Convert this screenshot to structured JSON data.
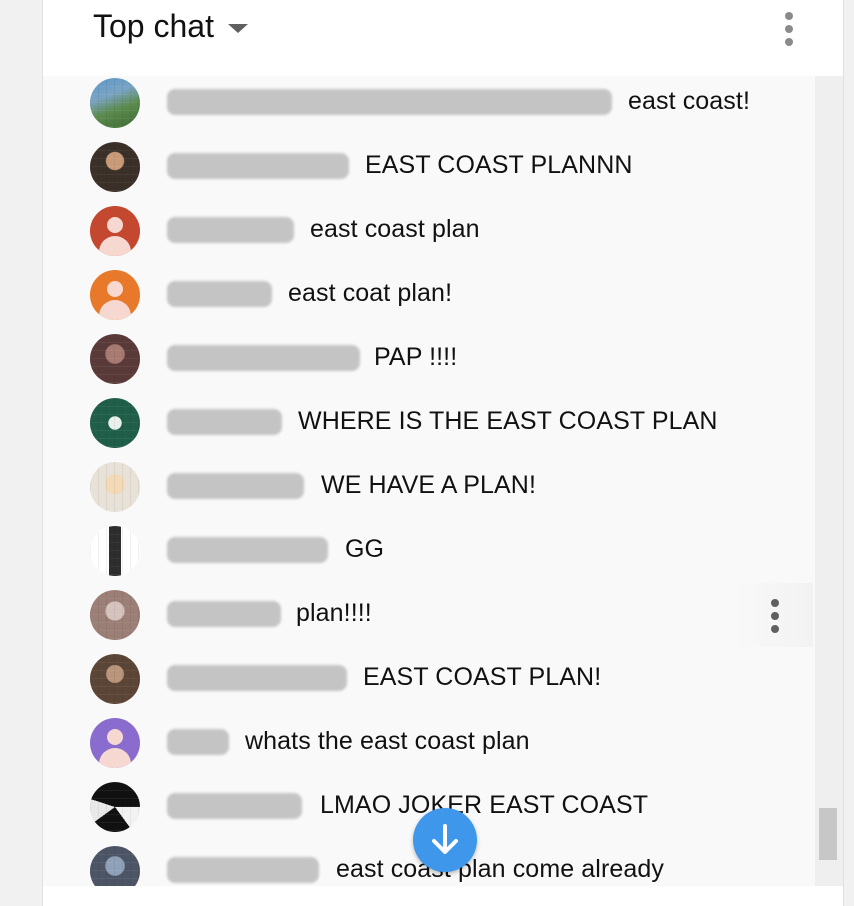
{
  "header": {
    "title": "Top chat"
  },
  "colors": {
    "accent": "#3f97ec"
  },
  "messages": [
    {
      "avatar": "landscape-avatar",
      "author_width": 445,
      "text": "east coast!"
    },
    {
      "avatar": "photo-avatar",
      "author_width": 182,
      "text": "EAST COAST PLANNN"
    },
    {
      "avatar": "default-user-avatar-red",
      "author_width": 127,
      "text": "east coast plan"
    },
    {
      "avatar": "default-user-avatar-orange",
      "author_width": 105,
      "text": "east coat plan!"
    },
    {
      "avatar": "photo-avatar",
      "author_width": 193,
      "text": "PAP !!!!"
    },
    {
      "avatar": "green-logo-avatar",
      "author_width": 115,
      "text": "WHERE IS THE EAST COAST PLAN"
    },
    {
      "avatar": "cartoon-avatar",
      "author_width": 137,
      "text": "WE HAVE A PLAN!"
    },
    {
      "avatar": "figure-avatar",
      "author_width": 161,
      "text": "GG"
    },
    {
      "avatar": "photo-avatar",
      "author_width": 114,
      "text": "plan!!!!"
    },
    {
      "avatar": "photo-avatar",
      "author_width": 180,
      "text": "EAST COAST PLAN!"
    },
    {
      "avatar": "default-user-avatar-purple",
      "author_width": 62,
      "text": "whats the east coast plan"
    },
    {
      "avatar": "black-white-avatar",
      "author_width": 135,
      "text": "LMAO JOKER EAST COAST"
    },
    {
      "avatar": "photo-avatar",
      "author_width": 152,
      "text": "east coast plan come already"
    }
  ]
}
